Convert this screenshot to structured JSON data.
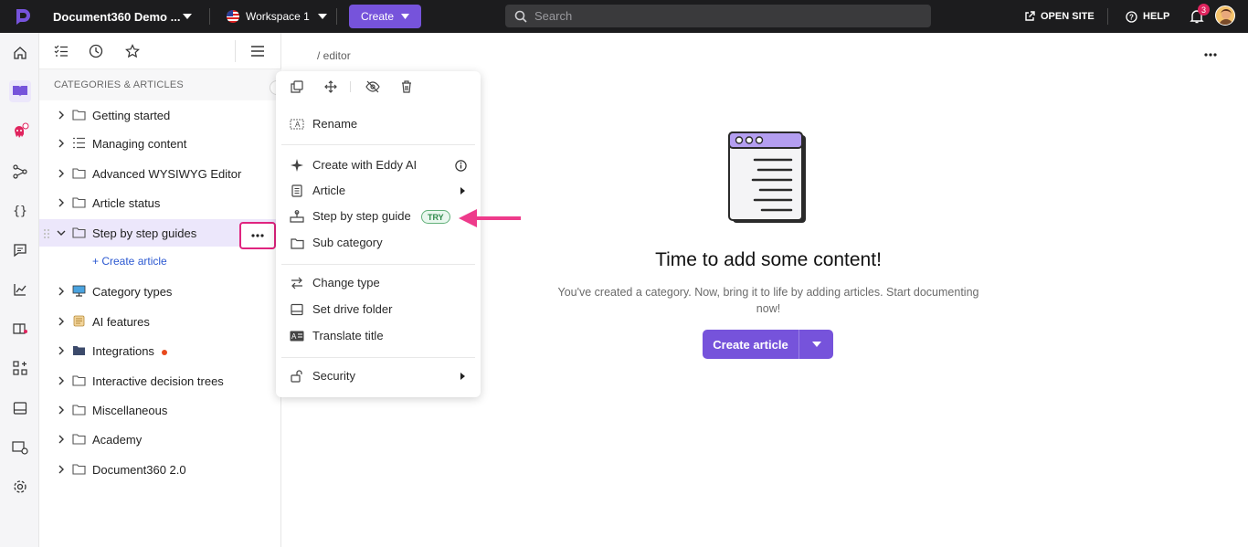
{
  "topbar": {
    "project_name": "Document360 Demo ...",
    "workspace": "Workspace 1",
    "create_label": "Create",
    "search_placeholder": "Search",
    "open_site_label": "OPEN SITE",
    "help_label": "HELP",
    "notification_count": "3",
    "colors": {
      "background": "#1c1c1e",
      "accent": "#7653db",
      "badge": "#e0245e"
    }
  },
  "rail": {
    "icons": [
      "home-icon",
      "knowledge-base-icon",
      "eddy-ai-icon",
      "workflow-icon",
      "api-docs-icon",
      "feedback-icon",
      "analytics-icon",
      "widget-icon",
      "integrations-icon",
      "drive-icon",
      "portal-icon",
      "settings-icon"
    ],
    "active": "knowledge-base-icon"
  },
  "tree": {
    "header": "CATEGORIES & ARTICLES",
    "create_article_label": "+ Create article",
    "items": [
      {
        "label": "Getting started",
        "icon": "folder-icon"
      },
      {
        "label": "Managing content",
        "icon": "list-icon"
      },
      {
        "label": "Advanced WYSIWYG Editor",
        "icon": "folder-icon"
      },
      {
        "label": "Article status",
        "icon": "folder-icon"
      },
      {
        "label": "Step by step guides",
        "icon": "folder-icon",
        "selected": true,
        "expanded": true
      },
      {
        "label": "Category types",
        "icon": "monitor-emoji-icon"
      },
      {
        "label": "AI features",
        "icon": "scroll-emoji-icon"
      },
      {
        "label": "Integrations",
        "icon": "folder-filled-icon",
        "has_dot": true
      },
      {
        "label": "Interactive decision trees",
        "icon": "folder-icon"
      },
      {
        "label": "Miscellaneous",
        "icon": "folder-icon"
      },
      {
        "label": "Academy",
        "icon": "folder-icon"
      },
      {
        "label": "Document360 2.0",
        "icon": "folder-icon"
      }
    ]
  },
  "menu": {
    "tools": [
      "copy-icon",
      "move-icon",
      "hide-icon",
      "delete-icon"
    ],
    "items": [
      {
        "label": "Rename",
        "icon": "rename-icon"
      },
      {
        "label": "Create with Eddy AI",
        "icon": "sparkle-icon",
        "right": "info-icon"
      },
      {
        "label": "Article",
        "icon": "article-icon",
        "right": "submenu-arrow-icon"
      },
      {
        "label": "Step by step guide",
        "icon": "guide-icon",
        "badge": "TRY"
      },
      {
        "label": "Sub category",
        "icon": "folder-icon"
      },
      {
        "label": "Change type",
        "icon": "swap-icon"
      },
      {
        "label": "Set drive folder",
        "icon": "drive-icon"
      },
      {
        "label": "Translate title",
        "icon": "translate-icon"
      },
      {
        "label": "Security",
        "icon": "lock-icon",
        "right": "submenu-arrow-icon"
      }
    ]
  },
  "main": {
    "breadcrumb": "/ editor",
    "empty_title": "Time to add some content!",
    "empty_desc": "You've created a category. Now, bring it to life by adding articles. Start documenting now!",
    "create_article_label": "Create article"
  }
}
